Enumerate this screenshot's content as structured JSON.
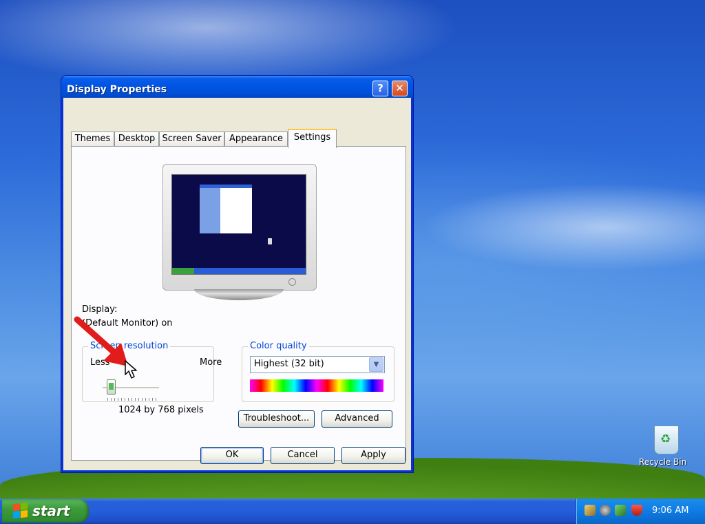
{
  "window": {
    "title": "Display Properties",
    "help_symbol": "?",
    "close_symbol": "✕"
  },
  "tabs": [
    {
      "label": "Themes",
      "selected": false
    },
    {
      "label": "Desktop",
      "selected": false
    },
    {
      "label": "Screen Saver",
      "selected": false
    },
    {
      "label": "Appearance",
      "selected": false
    },
    {
      "label": "Settings",
      "selected": true
    }
  ],
  "settings": {
    "display_label": "Display:",
    "display_value": "(Default Monitor) on",
    "resolution_group_title": "Screen resolution",
    "slider_less": "Less",
    "slider_more": "More",
    "resolution_value": "1024 by 768 pixels",
    "color_group_title": "Color quality",
    "color_selected": "Highest (32 bit)",
    "troubleshoot_label": "Troubleshoot...",
    "advanced_label": "Advanced"
  },
  "dialog_buttons": {
    "ok": "OK",
    "cancel": "Cancel",
    "apply": "Apply"
  },
  "desktop": {
    "recycle_bin_label": "Recycle Bin"
  },
  "taskbar": {
    "start_label": "start",
    "clock": "9:06 AM"
  }
}
